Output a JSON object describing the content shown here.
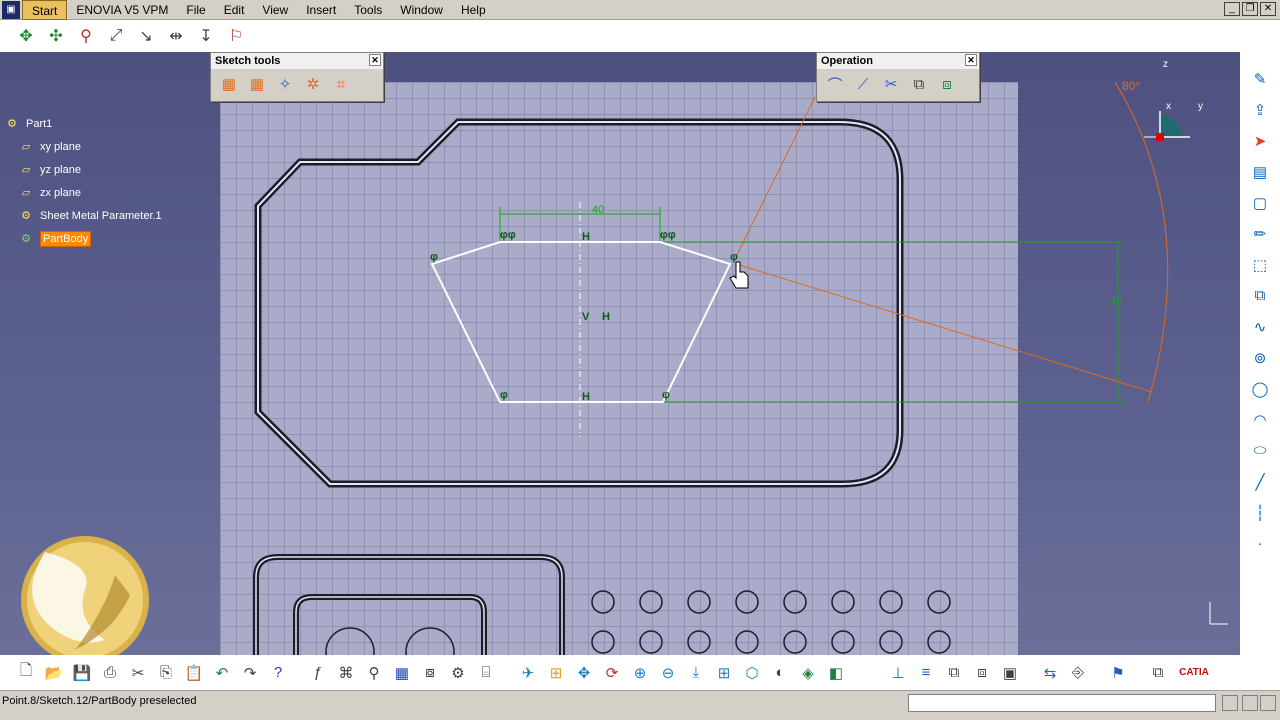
{
  "menubar": {
    "items": [
      "Start",
      "ENOVIA V5 VPM",
      "File",
      "Edit",
      "View",
      "Insert",
      "Tools",
      "Window",
      "Help"
    ],
    "window_controls": [
      "_",
      "❐",
      "✕"
    ]
  },
  "tree": {
    "root": "Part1",
    "items": [
      "xy plane",
      "yz plane",
      "zx plane",
      "Sheet Metal Parameter.1",
      "PartBody"
    ],
    "selected": "PartBody"
  },
  "sketch_tools": {
    "title": "Sketch tools"
  },
  "operation": {
    "title": "Operation"
  },
  "sketch": {
    "dim_top": "40",
    "dim_right": "40",
    "constraint_h": "H",
    "constraint_v": "V",
    "angle": "80°",
    "axis_x": "x",
    "axis_y": "y",
    "axis_z": "z"
  },
  "brand": "CATIA",
  "status": {
    "text": "Point.8/Sketch.12/PartBody preselected"
  },
  "colors": {
    "accent": "#ff8a00",
    "background": "#5a5d86",
    "dim_green": "#17a817",
    "orange": "#e06a1a"
  }
}
